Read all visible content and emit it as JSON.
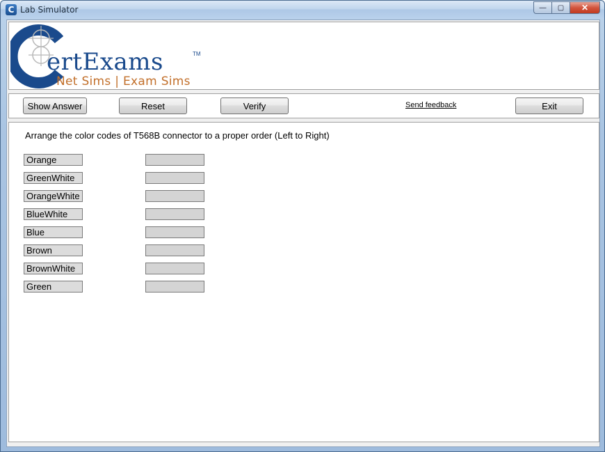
{
  "window": {
    "title": "Lab Simulator",
    "icon_letter": "C",
    "controls": {
      "minimize": "—",
      "maximize": "▢",
      "close": "✕"
    }
  },
  "logo": {
    "word": "ertExams",
    "tm": "TM",
    "tagline": "Net Sims | Exam Sims",
    "colors": {
      "primary": "#1a4a8c",
      "accent": "#c26f2a"
    }
  },
  "toolbar": {
    "show_answer": "Show Answer",
    "reset": "Reset",
    "verify": "Verify",
    "feedback": "Send feedback",
    "exit": "Exit"
  },
  "question": {
    "text": "Arrange the color codes of T568B connector to a proper order (Left to Right)",
    "options": [
      "Orange",
      "GreenWhite",
      "OrangeWhite",
      "BlueWhite",
      "Blue",
      "Brown",
      "BrownWhite",
      "Green"
    ],
    "slots": [
      "",
      "",
      "",
      "",
      "",
      "",
      "",
      ""
    ]
  }
}
